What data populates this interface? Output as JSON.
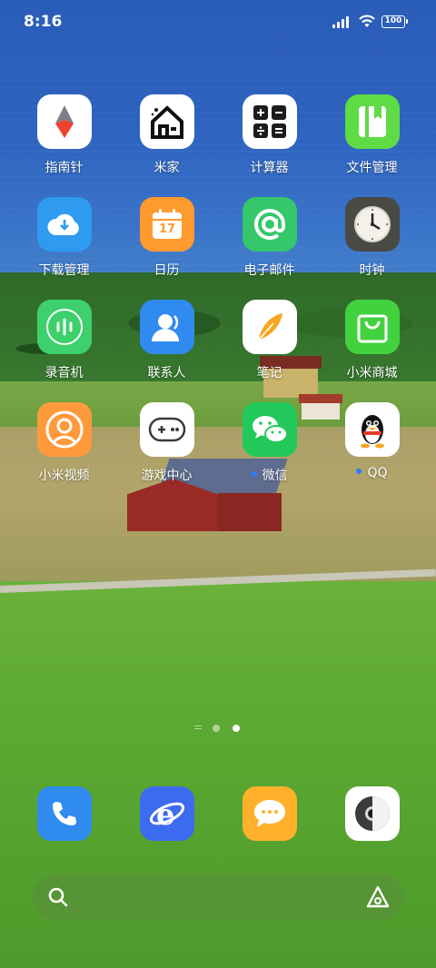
{
  "status_bar": {
    "time": "8:16",
    "battery": "100"
  },
  "apps": [
    {
      "name": "compass",
      "label": "指南针"
    },
    {
      "name": "mi-home",
      "label": "米家"
    },
    {
      "name": "calculator",
      "label": "计算器"
    },
    {
      "name": "file-manager",
      "label": "文件管理"
    },
    {
      "name": "downloads",
      "label": "下载管理"
    },
    {
      "name": "calendar",
      "label": "日历",
      "day": "17"
    },
    {
      "name": "email",
      "label": "电子邮件"
    },
    {
      "name": "clock",
      "label": "时钟"
    },
    {
      "name": "recorder",
      "label": "录音机"
    },
    {
      "name": "contacts",
      "label": "联系人"
    },
    {
      "name": "notes",
      "label": "笔记"
    },
    {
      "name": "mi-store",
      "label": "小米商城"
    },
    {
      "name": "mi-video",
      "label": "小米视频"
    },
    {
      "name": "game-center",
      "label": "游戏中心"
    },
    {
      "name": "wechat",
      "label": "微信"
    },
    {
      "name": "qq",
      "label": "QQ"
    }
  ],
  "dock": [
    {
      "name": "phone"
    },
    {
      "name": "browser"
    },
    {
      "name": "messages"
    },
    {
      "name": "camera"
    }
  ],
  "colors": {
    "accent_dot": "#2f7cff"
  }
}
